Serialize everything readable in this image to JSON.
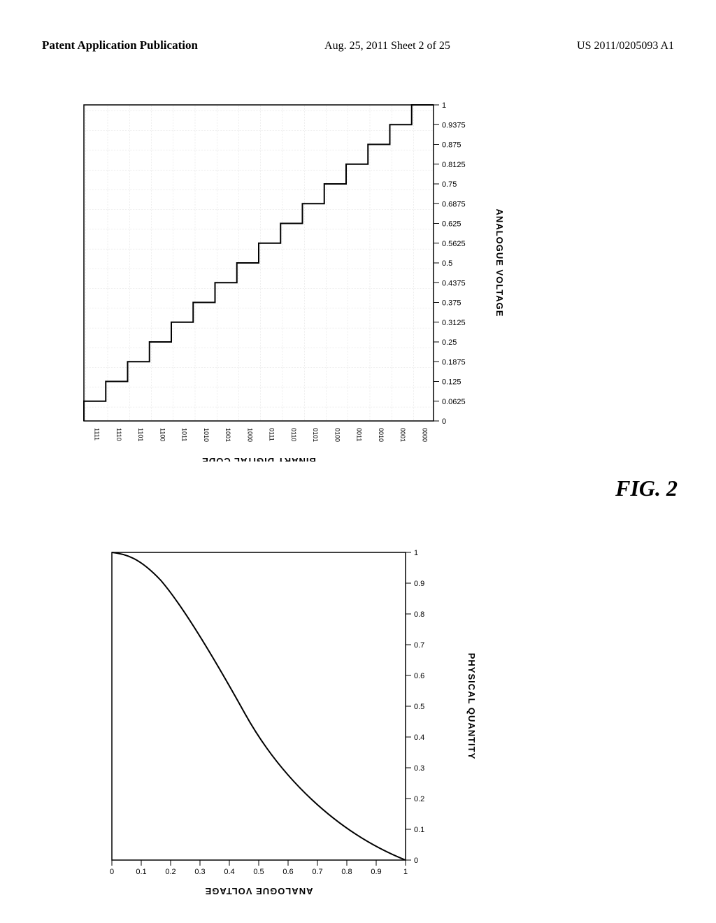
{
  "header": {
    "left": "Patent Application Publication",
    "center": "Aug. 25, 2011   Sheet 2 of 25",
    "right": "US 2011/0205093 A1"
  },
  "fig_label": "FIG. 2",
  "top_chart": {
    "title": "ANALOGUE VOLTAGE",
    "x_axis_label": "BINARY DIGITAL CODE",
    "y_ticks": [
      "1",
      "0.9375",
      "0.875",
      "0.8125",
      "0.75",
      "0.6875",
      "0.625",
      "0.5625",
      "0.5",
      "0.4375",
      "0.375",
      "0.3125",
      "0.25",
      "0.1875",
      "0.125",
      "0.0625",
      "0"
    ],
    "x_ticks": [
      "1111",
      "1110",
      "1101",
      "1100",
      "1011",
      "1010",
      "1001",
      "1000",
      "0111",
      "0110",
      "0101",
      "0100",
      "0011",
      "0010",
      "0001",
      "0000"
    ]
  },
  "bottom_chart": {
    "x_axis_label": "ANALOGUE VOLTAGE",
    "y_axis_label": "PHYSICAL QUANTITY",
    "x_ticks": [
      "0",
      "0.1",
      "0.2",
      "0.3",
      "0.4",
      "0.5",
      "0.6",
      "0.7",
      "0.8",
      "0.9",
      "1"
    ],
    "y_ticks": [
      "0",
      "0.1",
      "0.2",
      "0.3",
      "0.4",
      "0.5",
      "0.6",
      "0.7",
      "0.8",
      "0.9",
      "1"
    ]
  }
}
